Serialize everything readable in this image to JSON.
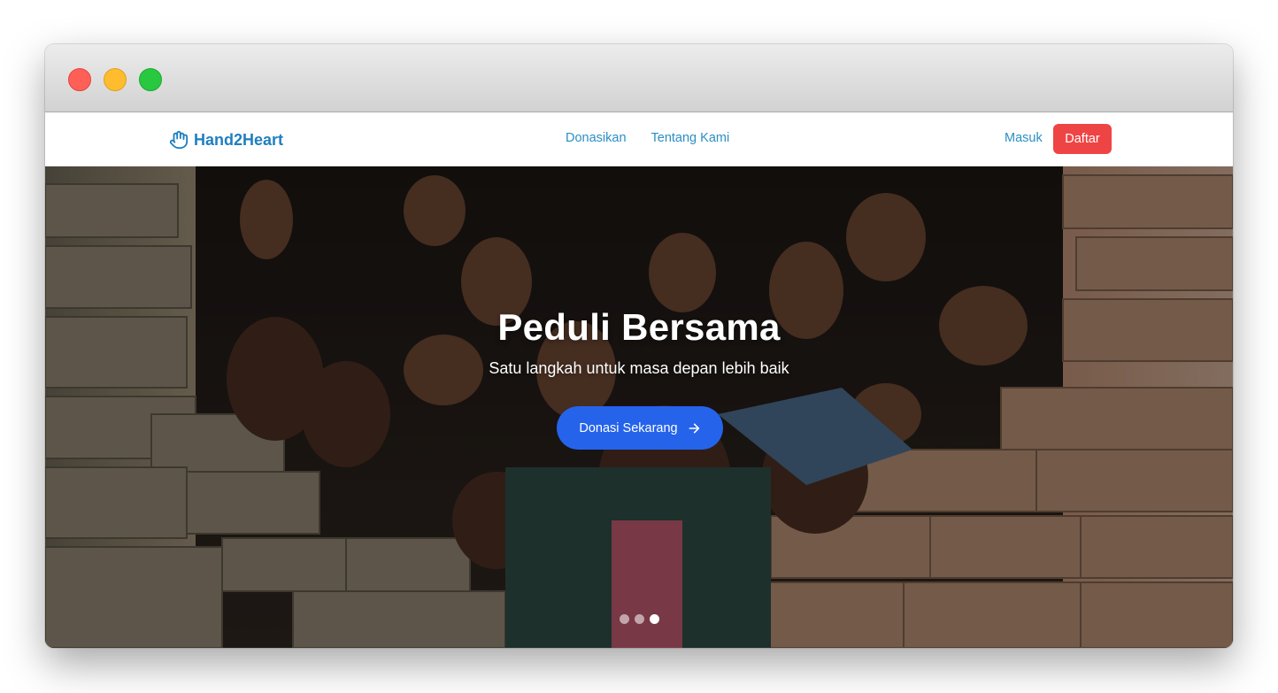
{
  "navbar": {
    "brand_icon": "raised-hand-icon",
    "brand_name": "Hand2Heart",
    "links": [
      {
        "label": "Donasikan"
      },
      {
        "label": "Tentang Kami"
      }
    ],
    "login_label": "Masuk",
    "register_label": "Daftar"
  },
  "hero": {
    "title": "Peduli Bersama",
    "subtitle": "Satu langkah untuk masa depan lebih baik",
    "cta_label": "Donasi Sekarang",
    "cta_icon": "arrow-right-icon",
    "background_image": "children-waving-hands-through-brick-window",
    "slides_total": 3,
    "active_slide": 3
  },
  "colors": {
    "brand": "#1e7fbf",
    "nav_link": "#2a8fc4",
    "register_button": "#ef4444",
    "cta_button": "#2563eb"
  }
}
